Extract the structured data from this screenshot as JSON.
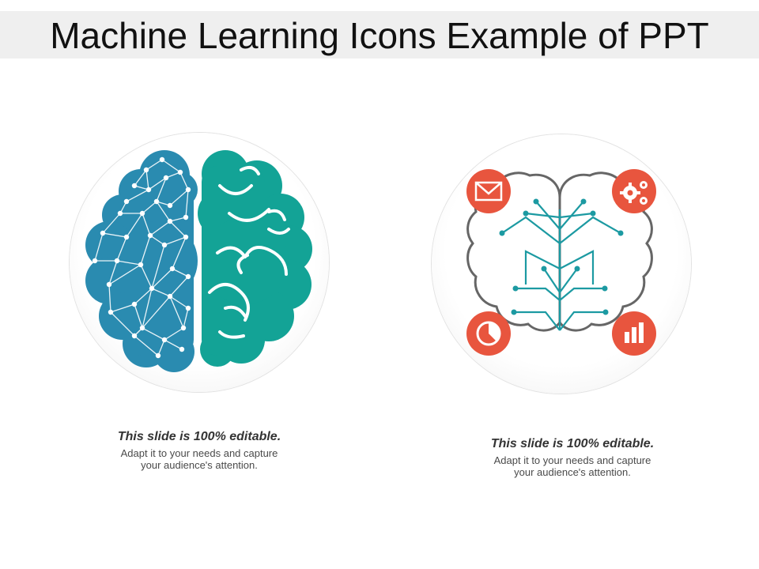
{
  "slide": {
    "title": "Machine Learning Icons Example of PPT"
  },
  "left_panel": {
    "icon": "brain-network-icon",
    "heading": "This slide is 100% editable.",
    "body_line1": "Adapt it to your needs and capture",
    "body_line2": "your audience's attention."
  },
  "right_panel": {
    "icon": "brain-circuit-icon",
    "corner_icons": [
      "envelope-icon",
      "gears-icon",
      "pie-chart-icon",
      "bar-chart-icon"
    ],
    "heading": "This slide is 100% editable.",
    "body_line1": "Adapt it to your needs and capture",
    "body_line2": "your audience's attention."
  },
  "colors": {
    "blue": "#2a8bb0",
    "teal": "#13a396",
    "red": "#e8553e",
    "outline": "#666666",
    "circuit": "#1c9aa2"
  }
}
